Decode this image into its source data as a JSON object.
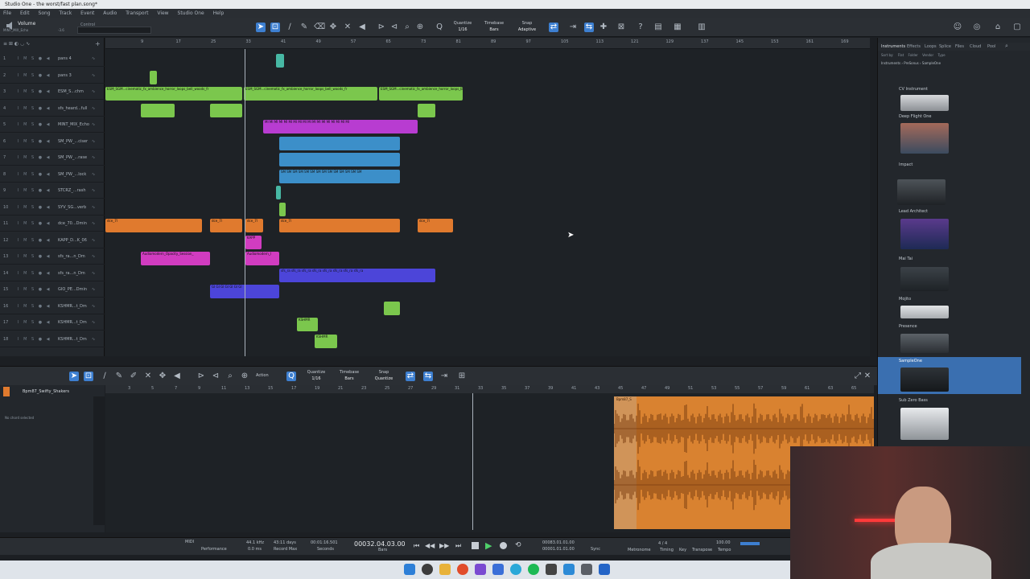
{
  "app": {
    "title": "Studio One - the worst/fast plan.song*",
    "menu": [
      "File",
      "Edit",
      "Song",
      "Track",
      "Event",
      "Audio",
      "Transport",
      "View",
      "Studio One",
      "Help"
    ]
  },
  "toolbar": {
    "channel_label": "Volume",
    "channel_sub": "MINT_MIX_Echo",
    "channel_value": "-3.6",
    "control_label": "Control",
    "quantize_label": "Quantize",
    "quantize_value": "1/16",
    "timebase_label": "Timebase",
    "timebase_value": "Bars",
    "snap_label": "Snap",
    "snap_value": "Adaptive"
  },
  "tracks": [
    {
      "num": "1",
      "name": "pans 4"
    },
    {
      "num": "2",
      "name": "pans 3"
    },
    {
      "num": "3",
      "name": "ESM_S...chm"
    },
    {
      "num": "4",
      "name": "sfs_heard...full"
    },
    {
      "num": "5",
      "name": "MINT_MIX_Echo"
    },
    {
      "num": "6",
      "name": "SM_PW_...ciser"
    },
    {
      "num": "7",
      "name": "SM_PW_...rase"
    },
    {
      "num": "8",
      "name": "SM_PW_...lock"
    },
    {
      "num": "9",
      "name": "STCRZ_...rash"
    },
    {
      "num": "10",
      "name": "SYV_SG...verb"
    },
    {
      "num": "11",
      "name": "dce_70...Dmin"
    },
    {
      "num": "12",
      "name": "KAPP_D...K_06"
    },
    {
      "num": "13",
      "name": "sfs_ra...n_Dm"
    },
    {
      "num": "14",
      "name": "sfs_ra...n_Dm"
    },
    {
      "num": "15",
      "name": "GIO_PE...Dmin"
    },
    {
      "num": "16",
      "name": "KSHMR...t_Dm"
    },
    {
      "num": "17",
      "name": "KSHMR...t_Dm"
    },
    {
      "num": "18",
      "name": "KSHMR...t_Dm"
    }
  ],
  "ruler_ticks": [
    "9",
    "17",
    "25",
    "33",
    "41",
    "49",
    "57",
    "65",
    "73",
    "81",
    "89",
    "97",
    "105",
    "113",
    "121",
    "129",
    "137",
    "145",
    "153",
    "161",
    "169"
  ],
  "clips": {
    "ESM": "ESM_SGM...cinematic_fx_ambience_horror_loops_bell_woods_fr",
    "MINT": "MI MI MI MI MI MI MI MI MI MI MI MI MI MI MI MI MI MI",
    "SM": "SM SM SM SM SM SM SM SM SM SM SM SM SM SM",
    "dce": "dce_7l",
    "kapp": "KAPP",
    "audiomodern1": "Audiomodern_Opacity_Session_",
    "audiomodern2": "Audiomodern_l",
    "sfs": "sfs_ra sfs_ra sfs_ra sfs_ra sfs_ra sfs_ra sfs_ra sfs_ra",
    "gio": "GI GI GI GI GI GI GI",
    "kshmr": "KSHMR"
  },
  "editor": {
    "track_name": "Bpm87_Swifty_Shakers",
    "chord_status": "No chord selected",
    "action_label": "Action",
    "quantize_label": "Quantize",
    "quantize_value": "1/16",
    "timebase_label": "Timebase",
    "timebase_value": "Bars",
    "snap_label": "Snap",
    "snap_value": "Quantize",
    "clip_label": "Bpm87_S",
    "ruler_ticks": [
      "3",
      "5",
      "7",
      "9",
      "11",
      "13",
      "15",
      "17",
      "19",
      "21",
      "23",
      "25",
      "27",
      "29",
      "31",
      "33",
      "35",
      "37",
      "39",
      "41",
      "43",
      "45",
      "47",
      "49",
      "51",
      "53",
      "55",
      "57",
      "59",
      "61",
      "63",
      "65"
    ]
  },
  "browser": {
    "tabs": [
      "Instruments",
      "Effects",
      "Loops",
      "Splice",
      "Files",
      "Cloud",
      "Pool"
    ],
    "sort_label": "Sort by:",
    "sort_options": [
      "Flat",
      "Folder",
      "Vendor",
      "Type"
    ],
    "breadcrumb": [
      "Instruments",
      "PreSonus",
      "SampleOne"
    ],
    "items": [
      "CV Instrument",
      "Deep Flight One",
      "Impact",
      "Lead Architect",
      "Mai Tai",
      "Mojito",
      "Presence",
      "SampleOne",
      "Sub Zero Bass"
    ],
    "selected_item": "SampleOne"
  },
  "transport": {
    "midi_label": "MIDI",
    "performance_label": "Performance",
    "sample_rate": "44.1 kHz",
    "latency": "0.0 ms",
    "record_max": "43:11 days",
    "record_max_label": "Record Max",
    "seconds": "00:01:16.501",
    "seconds_label": "Seconds",
    "position": "00032.04.03.00",
    "position_label": "Bars",
    "loop_start": "00083.01.01.00",
    "loop_end": "00001.01.01.00",
    "sync_label": "Sync",
    "signature": "4 / 4",
    "metronome_label": "Metronome",
    "timing_label": "Timing",
    "key_label": "Key",
    "tempo": "100.00",
    "tempo_label": "Tempo",
    "transpose_label": "Transpose"
  },
  "colors": {
    "green": "#7bc74d",
    "purple": "#b83cd1",
    "blue": "#3c8fc9",
    "orange": "#e07a2e",
    "magenta": "#d13cc0",
    "indigo": "#4c45d9",
    "teal": "#47b8a4",
    "accent": "#3d7fd0"
  }
}
